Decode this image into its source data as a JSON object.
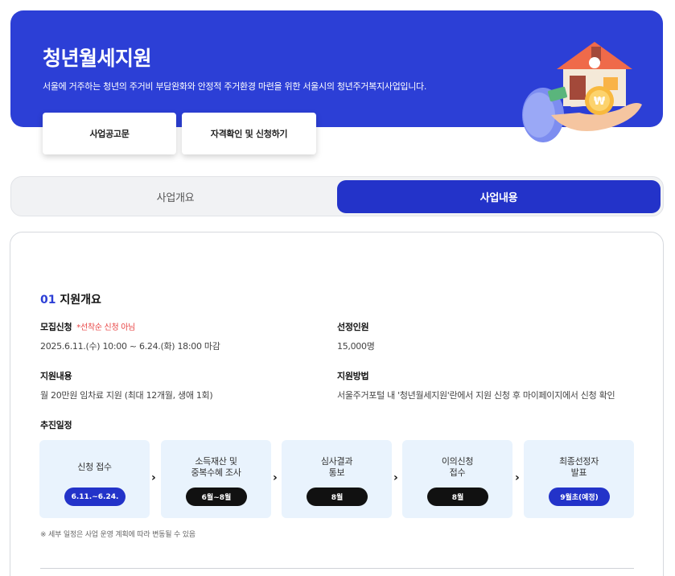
{
  "hero": {
    "title": "청년월세지원",
    "description": "서울에 거주하는 청년의 주거비 부담완화와 안정적 주거환경 마련을 위한 서울시의 청년주거복지사업입니다.",
    "buttons": [
      "사업공고문",
      "자격확인 및 신청하기"
    ],
    "illustration_icon": "house-on-hand-icon",
    "accent_color": "#2c3fd6"
  },
  "tabs": [
    {
      "label": "사업개요",
      "active": false
    },
    {
      "label": "사업내용",
      "active": true
    }
  ],
  "section": {
    "number": "01",
    "title": "지원개요",
    "fields": {
      "recruit_label": "모집신청",
      "recruit_note": "*선착순 신청 아님",
      "recruit_value": "2025.6.11.(수) 10:00 ~ 6.24.(화) 18:00 마감",
      "select_label": "선정인원",
      "select_value": "15,000명",
      "support_label": "지원내용",
      "support_value": "월 20만원 임차료 지원 (최대 12개월, 생애 1회)",
      "method_label": "지원방법",
      "method_value": "서울주거포털 내 '청년월세지원'란에서 지원 신청 후 마이페이지에서 신청 확인"
    },
    "schedule_label": "추진일정",
    "steps": [
      {
        "label_lines": [
          "신청 접수"
        ],
        "date": "6.11.~6.24.",
        "pill": "blue"
      },
      {
        "label_lines": [
          "소득재산 및",
          "중복수혜 조사"
        ],
        "date": "6월~8월",
        "pill": "black"
      },
      {
        "label_lines": [
          "심사결과",
          "통보"
        ],
        "date": "8월",
        "pill": "black"
      },
      {
        "label_lines": [
          "이의신청",
          "접수"
        ],
        "date": "8월",
        "pill": "black"
      },
      {
        "label_lines": [
          "최종선정자",
          "발표"
        ],
        "date": "9월초(예정)",
        "pill": "blue"
      }
    ],
    "footnote": "※ 세부 일정은 사업 운영 계획에 따라 변동될 수 있음"
  }
}
